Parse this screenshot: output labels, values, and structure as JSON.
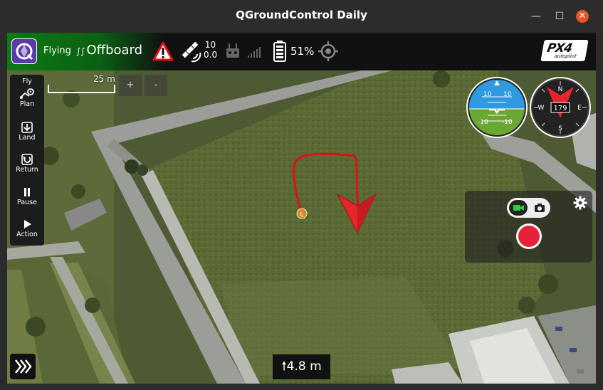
{
  "window": {
    "title": "QGroundControl Daily"
  },
  "toolbar": {
    "status": "Flying",
    "flight_mode": "Offboard",
    "gps": {
      "satellites": "10",
      "hdop": "0.0"
    },
    "battery": "51%",
    "logo_text": "PX4",
    "logo_sub": "autopilot"
  },
  "flytools": [
    {
      "label": "Fly",
      "icon": "fly-icon"
    },
    {
      "label": "Plan",
      "icon": "plan-icon"
    },
    {
      "label": "Land",
      "icon": "land-icon"
    },
    {
      "label": "Return",
      "icon": "return-icon"
    },
    {
      "label": "Pause",
      "icon": "pause-icon"
    },
    {
      "label": "Action",
      "icon": "play-icon"
    }
  ],
  "map": {
    "scale": "25 m",
    "zoom_in": "+",
    "zoom_out": "-",
    "launch_marker": "L"
  },
  "attitude": {
    "pitch_up": "10",
    "pitch_down": "-10"
  },
  "compass": {
    "heading": "179",
    "n": "N",
    "e": "E",
    "s": "S",
    "w": "W"
  },
  "altitude": "4.8 m",
  "colors": {
    "flying_green": "#0d7a15",
    "vehicle_red": "#e8242b",
    "record_red": "#e8213a",
    "path_red": "#e01010"
  }
}
